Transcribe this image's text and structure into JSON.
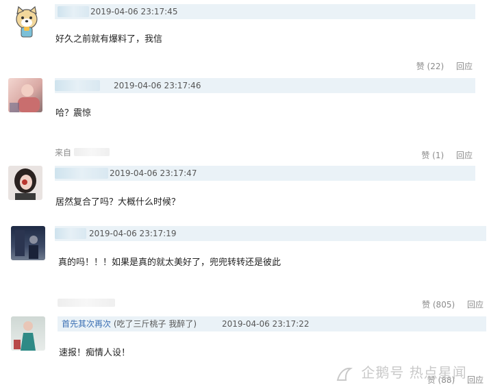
{
  "colors": {
    "header_bg": "#eaf2f7",
    "username": "#3b6fb3",
    "meta_text": "#8a8a8a"
  },
  "comments": [
    {
      "time": "2019-04-06 23:17:45",
      "text": "好久之前就有爆料了，我信",
      "like_label": "赞 (22)",
      "reply_label": "回应"
    },
    {
      "time": "2019-04-06 23:17:46",
      "text": "哈？震惊",
      "from_label": "来自",
      "like_label": "赞 (1)",
      "reply_label": "回应"
    },
    {
      "time": "2019-04-06 23:17:47",
      "text": "居然复合了吗？大概什么时候？"
    },
    {
      "time": "2019-04-06 23:17:19",
      "text": "真的吗！！！如果是真的就太美好了，兜兜转转还是彼此",
      "like_label": "赞 (805)",
      "reply_label": "回应"
    },
    {
      "username": "首先其次再次",
      "nickname": "(吃了三斤桃子 我醉了)",
      "time": "2019-04-06 23:17:22",
      "text": "速报！痴情人设！",
      "like_label": "赞 (88)",
      "reply_label": "回应"
    }
  ],
  "watermark": "企鹅号 热点星闻"
}
